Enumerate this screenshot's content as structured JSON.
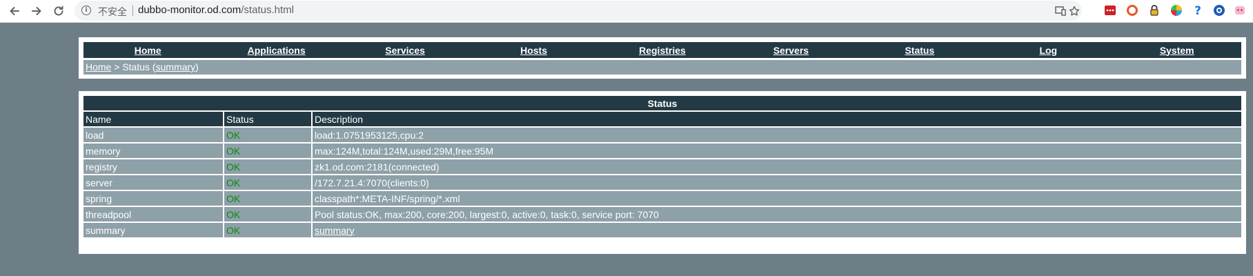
{
  "browser": {
    "security_label": "不安全",
    "url_host": "dubbo-monitor.od.com",
    "url_path": "/status.html"
  },
  "menu": {
    "items": [
      {
        "label": "Home"
      },
      {
        "label": "Applications"
      },
      {
        "label": "Services"
      },
      {
        "label": "Hosts"
      },
      {
        "label": "Registries"
      },
      {
        "label": "Servers"
      },
      {
        "label": "Status"
      },
      {
        "label": "Log"
      },
      {
        "label": "System"
      }
    ]
  },
  "breadcrumb": {
    "home": "Home",
    "separator": " > ",
    "current": "Status",
    "open_paren": " (",
    "summary_link": "summary",
    "close_paren": ")"
  },
  "status_table": {
    "title": "Status",
    "headers": {
      "name": "Name",
      "status": "Status",
      "description": "Description"
    },
    "rows": [
      {
        "name": "load",
        "status": "OK",
        "description": "load:1.0751953125,cpu:2"
      },
      {
        "name": "memory",
        "status": "OK",
        "description": "max:124M,total:124M,used:29M,free:95M"
      },
      {
        "name": "registry",
        "status": "OK",
        "description": "zk1.od.com:2181(connected)"
      },
      {
        "name": "server",
        "status": "OK",
        "description": "/172.7.21.4:7070(clients:0)"
      },
      {
        "name": "spring",
        "status": "OK",
        "description": "classpath*:META-INF/spring/*.xml"
      },
      {
        "name": "threadpool",
        "status": "OK",
        "description": "Pool status:OK, max:200, core:200, largest:0, active:0, task:0, service port: 7070"
      },
      {
        "name": "summary",
        "status": "OK",
        "description": "summary"
      }
    ]
  },
  "colors": {
    "header_bg": "#233a45",
    "row_bg": "#8ea0a8",
    "page_bg": "#6e7e87",
    "ok_green": "#0a8a0a"
  }
}
